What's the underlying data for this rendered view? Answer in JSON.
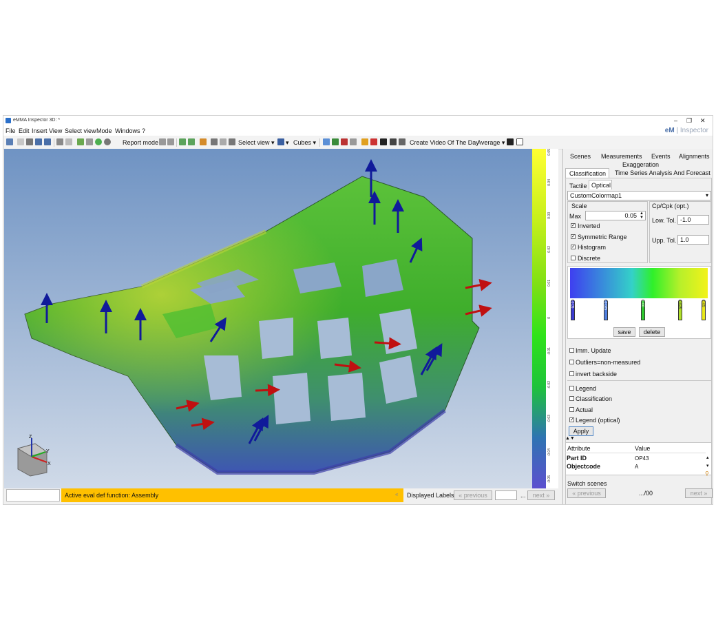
{
  "window": {
    "title": "eMMA Inspector 3D: *",
    "minimize": "–",
    "restore": "❐",
    "close": "✕"
  },
  "brand": {
    "em": "eM",
    "rest": " | Inspector"
  },
  "menu": [
    "File",
    "Edit",
    "Insert",
    "View",
    "Select view",
    "Mode",
    "Windows",
    "?"
  ],
  "toolbar": {
    "report_mode": "Report mode",
    "select_view": "Select view",
    "cubes": "Cubes",
    "create_video": "Create Video Of The Day",
    "average": "Average"
  },
  "colorbar": {
    "ticks": [
      "0.05",
      "0.04",
      "0.03",
      "0.02",
      "0.01",
      "0",
      "-0.01",
      "-0.02",
      "-0.03",
      "-0.04",
      "-0.05"
    ]
  },
  "status": {
    "active_eval": "Active eval def function: Assembly",
    "displayed_labels": "Displayed Labels",
    "previous": "« previous",
    "dots": "...",
    "next": "next »"
  },
  "panel": {
    "tabs_row1": [
      "Scenes",
      "Measurements",
      "Events",
      "Alignments"
    ],
    "tab_exaggeration": "Exaggeration",
    "tabs_row2": [
      "Classification",
      "Time Series Analysis And Forecast"
    ],
    "subtabs": [
      "Tactile",
      "Optical"
    ],
    "colormap": "CustomColormap1",
    "scale": "Scale",
    "max_label": "Max",
    "max_value": "0.05",
    "cp_label": "Cp/Cpk (opt.)",
    "low_tol_label": "Low. Tol.",
    "low_tol_value": "-1.0",
    "upp_tol_label": "Upp. Tol.",
    "upp_tol_value": "1.0",
    "checks_scale": [
      {
        "label": "Inverted",
        "checked": true
      },
      {
        "label": "Symmetric Range",
        "checked": true
      },
      {
        "label": "Histogram",
        "checked": true
      },
      {
        "label": "Discrete",
        "checked": false
      }
    ],
    "markers": [
      "-0.05",
      "-0.025",
      "0.00",
      "0.025",
      "0.05"
    ],
    "save": "save",
    "delete": "delete",
    "checks_opts": [
      {
        "label": "Imm. Update",
        "checked": false
      },
      {
        "label": "Outliers=non-measured",
        "checked": false
      },
      {
        "label": "invert backside",
        "checked": false
      }
    ],
    "checks_legend": [
      {
        "label": "Legend",
        "checked": false
      },
      {
        "label": "Classification",
        "checked": false
      },
      {
        "label": "Actual",
        "checked": false
      },
      {
        "label": "Legend (optical)",
        "checked": true
      }
    ],
    "apply": "Apply",
    "attr_header": "Attribute",
    "value_header": "Value",
    "rows": [
      {
        "attr": "Part ID",
        "value": "OP43"
      },
      {
        "attr": "Objectcode",
        "value": "A"
      }
    ],
    "switch_scenes": "Switch scenes",
    "sw_previous": "« previous",
    "sw_count": ".../00",
    "sw_next": "next »"
  },
  "colors": {
    "status_yellow": "#ffc000",
    "bg_top": "#6f93c3",
    "bg_bottom": "#cbd7e6"
  }
}
